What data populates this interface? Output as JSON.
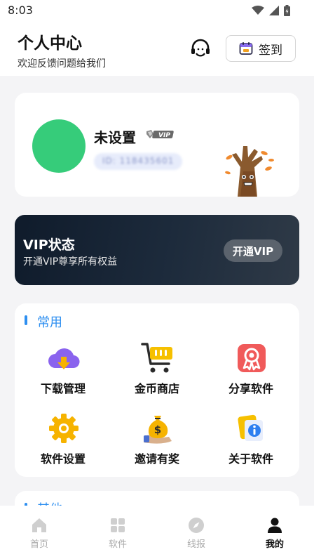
{
  "status_bar": {
    "time": "8:03"
  },
  "header": {
    "title": "个人中心",
    "subtitle": "欢迎反馈问题给我们",
    "checkin_label": "签到"
  },
  "profile": {
    "username": "未设置",
    "vip_badge": "VIP",
    "user_id": "ID: 118435601",
    "avatar_color": "#36cc7a"
  },
  "vip_card": {
    "title": "VIP状态",
    "subtitle": "开通VIP尊享所有权益",
    "button_label": "开通VIP"
  },
  "common": {
    "title": "常用",
    "items": [
      {
        "label": "下载管理",
        "icon": "cloud-download-icon"
      },
      {
        "label": "金币商店",
        "icon": "shopping-cart-icon"
      },
      {
        "label": "分享软件",
        "icon": "share-badge-icon"
      },
      {
        "label": "软件设置",
        "icon": "gear-icon"
      },
      {
        "label": "邀请有奖",
        "icon": "money-bag-icon"
      },
      {
        "label": "关于软件",
        "icon": "info-icon"
      }
    ]
  },
  "other": {
    "title": "其他"
  },
  "bottom_nav": {
    "items": [
      {
        "label": "首页",
        "icon": "home-icon",
        "active": false
      },
      {
        "label": "软件",
        "icon": "apps-grid-icon",
        "active": false
      },
      {
        "label": "线报",
        "icon": "compass-icon",
        "active": false
      },
      {
        "label": "我的",
        "icon": "user-icon",
        "active": true
      }
    ]
  },
  "colors": {
    "accent": "#2e8ff0",
    "page_background": "#f4f4f6",
    "vip_card_dark": "#0f1b2b"
  }
}
